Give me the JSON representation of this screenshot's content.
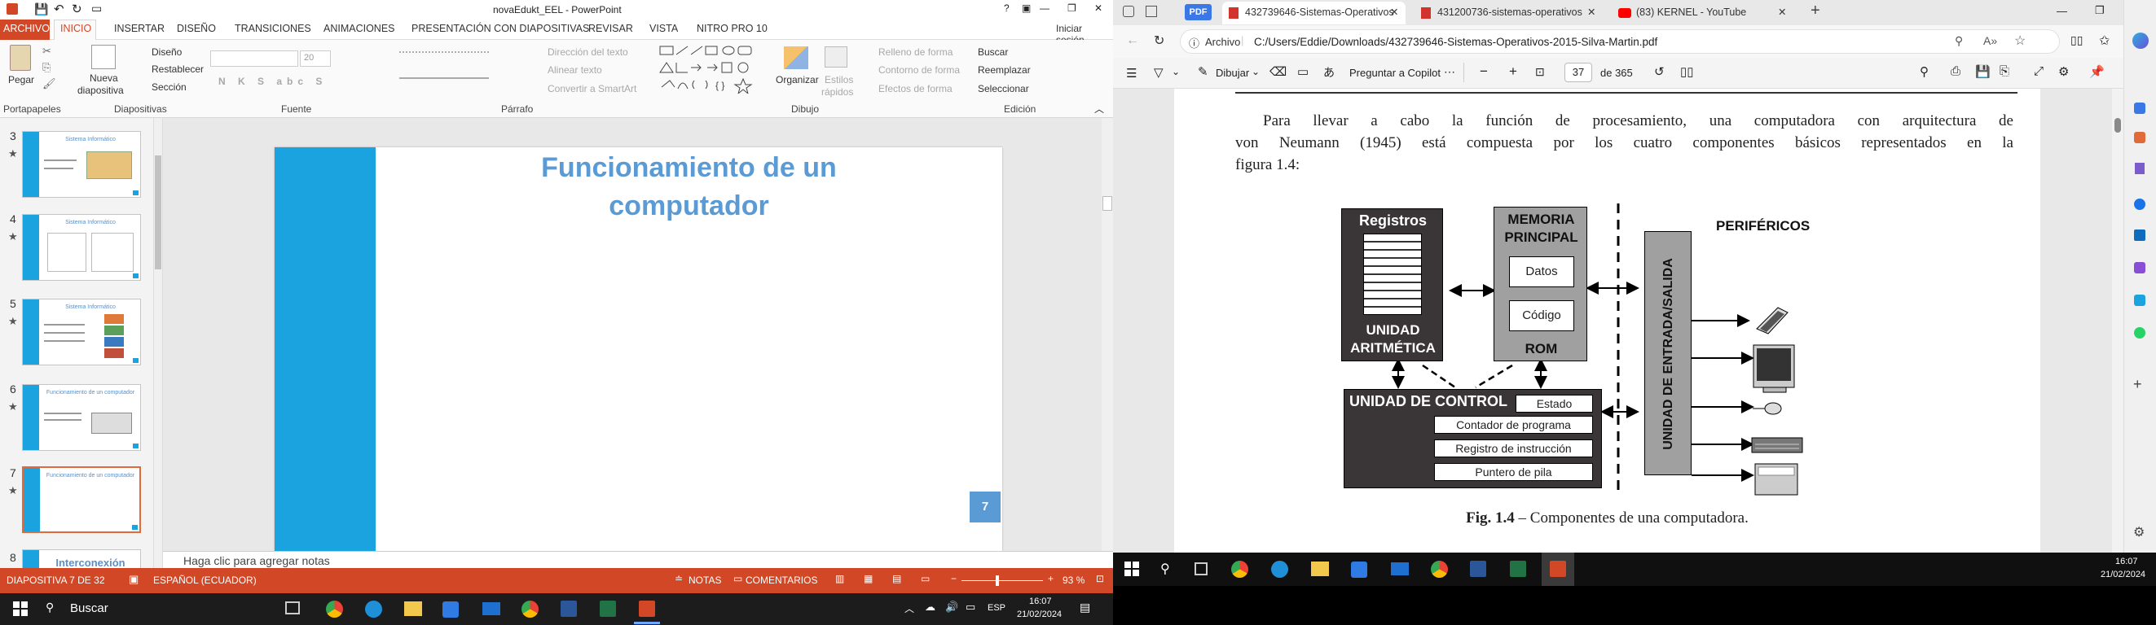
{
  "ppt": {
    "title": "novaEdukt_EEL - PowerPoint",
    "title_icons": [
      "?",
      "▣",
      "—",
      "❐",
      "✕"
    ],
    "tabs": [
      "ARCHIVO",
      "INICIO",
      "INSERTAR",
      "DISEÑO",
      "TRANSICIONES",
      "ANIMACIONES",
      "PRESENTACIÓN CON DIAPOSITIVAS",
      "REVISAR",
      "VISTA",
      "NITRO PRO 10"
    ],
    "signin": "Iniciar sesión",
    "ribbon": {
      "paste": "Pegar",
      "new_slide_1": "Nueva",
      "new_slide_2": "diapositiva",
      "layout": "Diseño",
      "reset": "Restablecer",
      "section": "Sección",
      "font_size": "20",
      "font_buttons": "N K S abc S",
      "text_dir": "Dirección del texto",
      "align_text": "Alinear texto",
      "smartart": "Convertir a SmartArt",
      "arrange": "Organizar",
      "styles_1": "Estilos",
      "styles_2": "rápidos",
      "fill": "Relleno de forma",
      "outline": "Contorno de forma",
      "effects": "Efectos de forma",
      "find": "Buscar",
      "replace": "Reemplazar",
      "select": "Seleccionar",
      "groups": [
        "Portapapeles",
        "Diapositivas",
        "Fuente",
        "Párrafo",
        "Dibujo",
        "Edición"
      ]
    },
    "thumbs": [
      {
        "num": "3",
        "title": "Sistema Informático"
      },
      {
        "num": "4",
        "title": "Sistema Informático"
      },
      {
        "num": "5",
        "title": "Sistema Informático"
      },
      {
        "num": "6",
        "title": "Funcionamiento de un computador"
      },
      {
        "num": "7",
        "title": "Funcionamiento de un computador"
      },
      {
        "num": "8",
        "title": "Interconexión"
      }
    ],
    "slide": {
      "title_line1": "Funcionamiento de un",
      "title_line2": "computador",
      "number": "7"
    },
    "notes_placeholder": "Haga clic para agregar notas",
    "status": {
      "slide_of": "DIAPOSITIVA 7 DE 32",
      "language": "ESPAÑOL (ECUADOR)",
      "notes": "NOTAS",
      "comments": "COMENTARIOS",
      "zoom": "93 %"
    }
  },
  "taskbar_left": {
    "search": "Buscar",
    "lang": "ESP",
    "time": "16:07",
    "date": "21/02/2024"
  },
  "taskbar_right": {
    "time": "16:07",
    "date": "21/02/2024"
  },
  "edge": {
    "tabs": [
      {
        "label": "432739646-Sistemas-Operativos",
        "active": true
      },
      {
        "label": "431200736-sistemas-operativos",
        "active": false
      },
      {
        "label": "(83) KERNEL - YouTube",
        "active": false
      }
    ],
    "pdf_badge": "PDF",
    "address_label": "Archivo",
    "address": "C:/Users/Eddie/Downloads/432739646-Sistemas-Operativos-2015-Silva-Martin.pdf",
    "toolbar": {
      "draw": "Dibujar",
      "copilot": "Preguntar a Copilot",
      "page": "37",
      "of_pages": "de 365"
    },
    "pdf": {
      "paragraph": [
        "Para llevar a cabo la función de procesamiento, una computadora con arquitectura de",
        "von Neumann (1945) está compuesta por los cuatro componentes básicos representados en la",
        "figura 1.4:"
      ],
      "diagram": {
        "registros": "Registros",
        "ua_1": "UNIDAD",
        "ua_2": "ARITMÉTICA",
        "mem_1": "MEMORIA",
        "mem_2": "PRINCIPAL",
        "datos": "Datos",
        "codigo": "Código",
        "rom": "ROM",
        "io": "UNIDAD DE ENTRADA/SALIDA",
        "perifericos": "PERIFÉRICOS",
        "uc": "UNIDAD DE CONTROL",
        "estado": "Estado",
        "contador": "Contador de programa",
        "registro": "Registro de instrucción",
        "puntero": "Puntero de pila"
      },
      "caption_bold": "Fig. 1.4",
      "caption_rest": " – Componentes de una computadora."
    }
  }
}
